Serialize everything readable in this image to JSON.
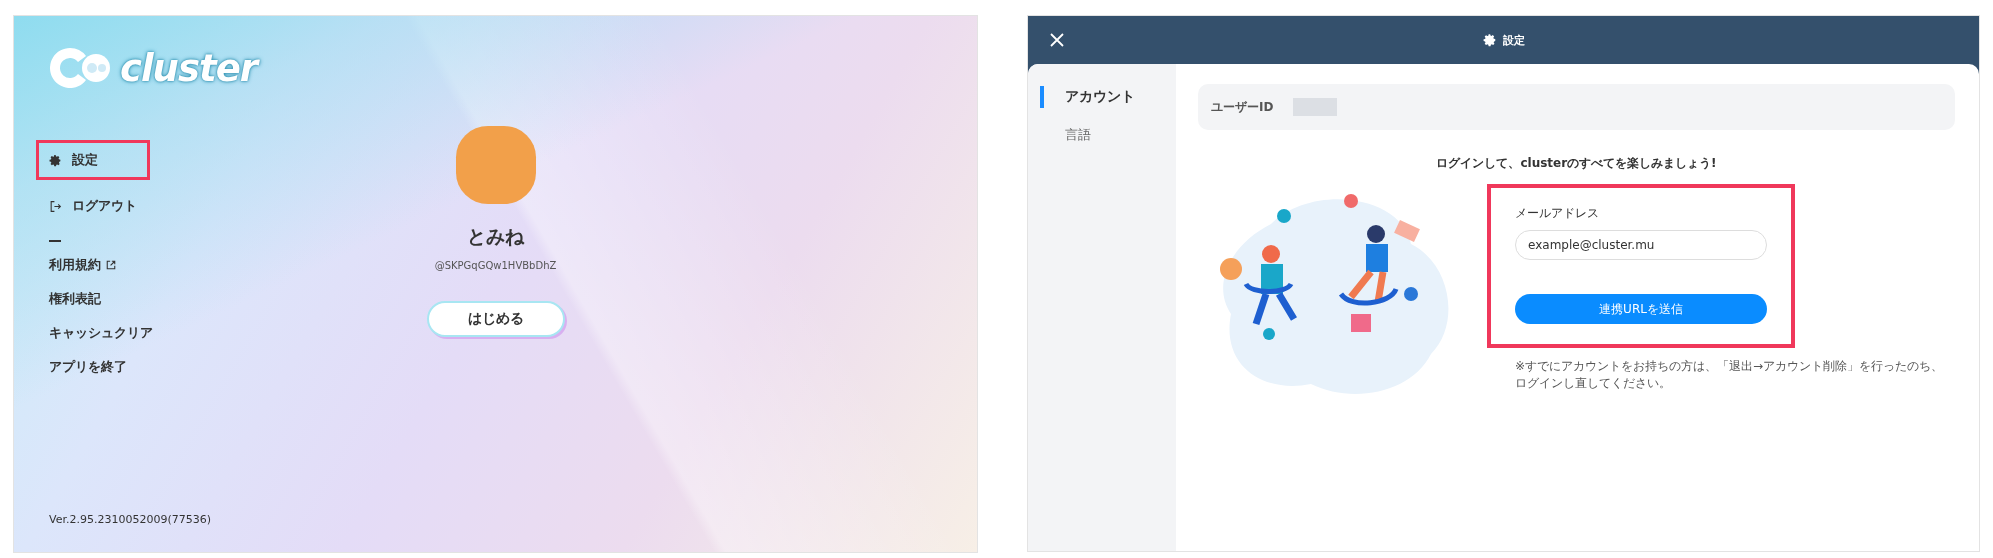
{
  "home": {
    "logo": "cluster",
    "menu": [
      {
        "label": "設定",
        "kind": "gear",
        "highlighted": true
      },
      {
        "label": "ログアウト",
        "kind": "logout",
        "highlighted": false
      }
    ],
    "links": [
      {
        "label": "利用規約",
        "external": true
      },
      {
        "label": "権利表記",
        "external": false
      },
      {
        "label": "キャッシュクリア",
        "external": false
      },
      {
        "label": "アプリを終了",
        "external": false
      }
    ],
    "profile": {
      "name": "とみね",
      "handle": "@SKPGqGQw1HVBbDhZ"
    },
    "start_button": "はじめる",
    "version": "Ver.2.95.2310052009(77536)"
  },
  "settings": {
    "title": "設定",
    "tabs": [
      {
        "label": "アカウント",
        "selected": true
      },
      {
        "label": "言語",
        "selected": false
      }
    ],
    "user_id_label": "ユーザーID",
    "heading": "ログインして、clusterのすべてを楽しみましょう!",
    "form_highlighted": true,
    "email": {
      "label": "メールアドレス",
      "placeholder": "example@cluster.mu"
    },
    "submit": "連携URLを送信",
    "note": "※すでにアカウントをお持ちの方は、「退出→アカウント削除」を行ったのち、ログインし直してください。"
  }
}
